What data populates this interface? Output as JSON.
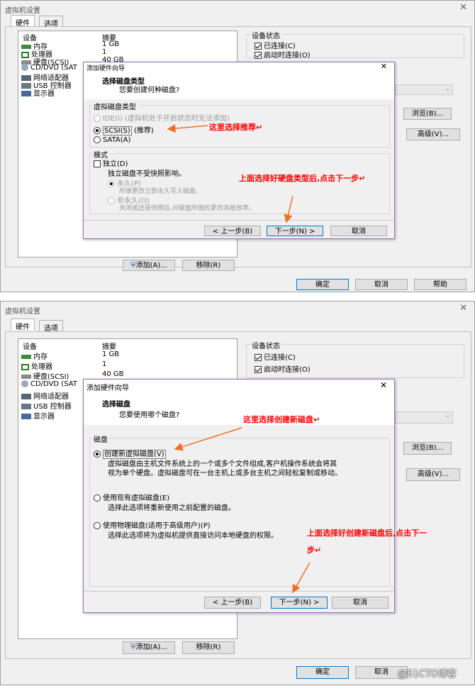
{
  "window_title": "虚拟机设置",
  "tabs": [
    "硬件",
    "选项"
  ],
  "device_table": {
    "headers": [
      "设备",
      "摘要"
    ],
    "rows": [
      {
        "name": "内存",
        "summary": "1 GB",
        "icon": "memory-icon"
      },
      {
        "name": "处理器",
        "summary": "1",
        "icon": "cpu-icon"
      },
      {
        "name": "硬盘(SCSI)",
        "summary": "40 GB",
        "icon": "hdd-icon"
      },
      {
        "name": "CD/DVD (SAT",
        "summary": "",
        "icon": "cdrom-icon"
      },
      {
        "name": "网络适配器",
        "summary": "",
        "icon": "network-icon"
      },
      {
        "name": "USB 控制器",
        "summary": "",
        "icon": "usb-icon"
      },
      {
        "name": "显示器",
        "summary": "",
        "icon": "display-icon"
      }
    ]
  },
  "device_status": {
    "label": "设备状态",
    "connected": "已连接(C)",
    "connect_on_start": "启动时连接(O)"
  },
  "right_buttons": {
    "browse": "浏览(B)...",
    "advanced": "高级(V)..."
  },
  "table_buttons": {
    "add": "添加(A)...",
    "remove": "移除(R)"
  },
  "bottom_buttons": {
    "ok": "确定",
    "cancel": "取消",
    "help": "帮助"
  },
  "wizard1": {
    "title": "添加硬件向导",
    "heading": "选择磁盘类型",
    "subheading": "您要创建何种磁盘?",
    "group_label": "虚拟磁盘类型",
    "options": [
      {
        "label": "IDE(I)",
        "note": "(虚拟机处于开启状态时无法添加)",
        "selected": false,
        "disabled": true
      },
      {
        "label": "SCSI(S)",
        "note": "(推荐)",
        "selected": true,
        "disabled": false
      },
      {
        "label": "SATA(A)",
        "note": "",
        "selected": false,
        "disabled": false
      }
    ],
    "mode_label": "模式",
    "independent": "独立(D)",
    "independent_desc": "独立磁盘不受快照影响。",
    "persistent": "永久(P)",
    "persistent_desc": "所做更改立即永久写入磁盘。",
    "nonpersistent": "非永久(O)",
    "nonpersistent_desc": "关闭或还原快照后,对磁盘所做的更改将被放弃。",
    "back": "< 上一步(B)",
    "next": "下一步(N) >",
    "cancel": "取消"
  },
  "wizard2": {
    "title": "添加硬件向导",
    "heading": "选择磁盘",
    "subheading": "您要使用哪个磁盘?",
    "group_label": "磁盘",
    "options": [
      {
        "label": "创建新虚拟磁盘(V)",
        "desc1": "虚拟磁盘由主机文件系统上的一个或多个文件组成,客户机操作系统会将其",
        "desc2": "视为单个硬盘。虚拟磁盘可在一台主机上或多台主机之间轻松复制或移动。",
        "selected": true
      },
      {
        "label": "使用现有虚拟磁盘(E)",
        "desc1": "选择此选项将重新使用之前配置的磁盘。",
        "desc2": "",
        "selected": false
      },
      {
        "label": "使用物理磁盘(适用于高级用户)(P)",
        "desc1": "选择此选项将为虚拟机提供直接访问本地硬盘的权限。",
        "desc2": "",
        "selected": false
      }
    ],
    "back": "< 上一步(B)",
    "next": "下一步(N) >",
    "cancel": "取消"
  },
  "annotations": {
    "a1": "这里选择推荐↵",
    "a2": "上面选择好硬盘类型后,点击下一步↵",
    "a3": "这里选择创建新磁盘↵",
    "a4_line1": "上面选择好创建新磁盘后,点击下一",
    "a4_line2": "步↵"
  },
  "watermark": "@51CTO博客",
  "colors": {
    "annotation": "#ff0000",
    "dialog_border": "#9a6fb0"
  }
}
